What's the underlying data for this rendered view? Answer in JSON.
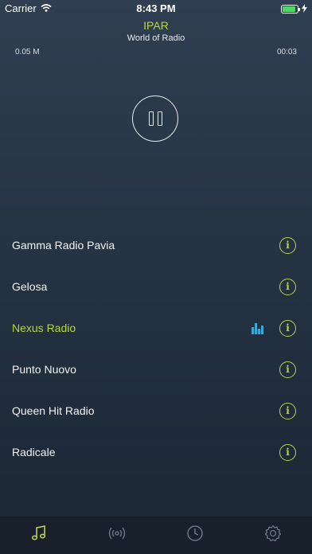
{
  "status": {
    "carrier": "Carrier",
    "time": "8:43 PM",
    "battery_level": 0.9
  },
  "header": {
    "title": "IPAR",
    "subtitle": "World of Radio"
  },
  "player": {
    "bitrate": "0.05 M",
    "elapsed": "00:03",
    "state": "playing"
  },
  "stations": [
    {
      "name": "Gamma Radio Pavia",
      "active": false
    },
    {
      "name": "Gelosa",
      "active": false
    },
    {
      "name": "Nexus Radio",
      "active": true
    },
    {
      "name": "Punto Nuovo",
      "active": false
    },
    {
      "name": "Queen Hit Radio",
      "active": false
    },
    {
      "name": "Radicale",
      "active": false
    }
  ],
  "tabs": [
    {
      "icon": "music-note-icon",
      "active": true
    },
    {
      "icon": "broadcast-icon",
      "active": false
    },
    {
      "icon": "clock-icon",
      "active": false
    },
    {
      "icon": "gear-icon",
      "active": false
    }
  ],
  "colors": {
    "accent": "#b9d63e",
    "background": "#263444",
    "tab_bar": "#17202b",
    "equalizer": "#3aa9d8"
  }
}
